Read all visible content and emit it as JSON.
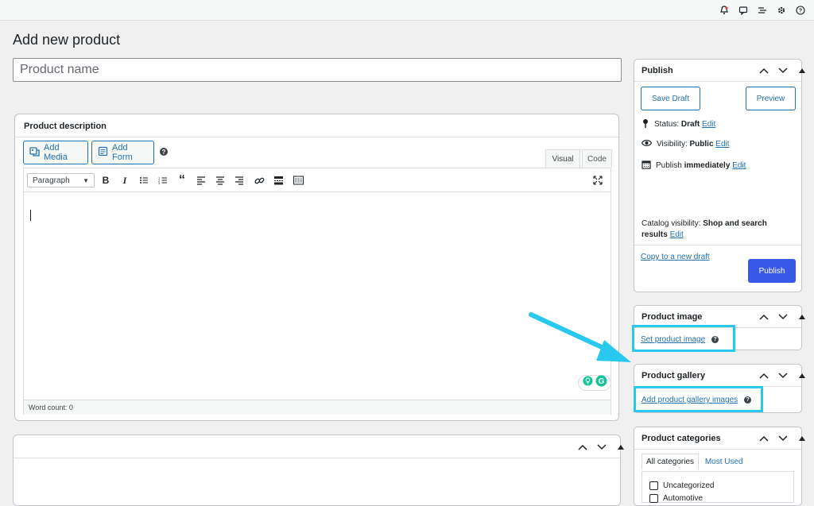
{
  "page": {
    "title": "Add new product"
  },
  "topbar": {
    "icons": [
      "bell-icon",
      "comment-icon",
      "list-icon",
      "gear-icon",
      "help-icon"
    ]
  },
  "product": {
    "name_placeholder": "Product name"
  },
  "description": {
    "title": "Product description",
    "add_media": "Add Media",
    "add_form": "Add Form",
    "tab_visual": "Visual",
    "tab_code": "Code",
    "format_select": "Paragraph",
    "word_count": "Word count: 0"
  },
  "publish": {
    "title": "Publish",
    "save_draft": "Save Draft",
    "preview": "Preview",
    "status_label": "Status:",
    "status_value": "Draft",
    "visibility_label": "Visibility:",
    "visibility_value": "Public",
    "publish_label": "Publish",
    "publish_value": "immediately",
    "edit": "Edit",
    "catalog_label": "Catalog visibility:",
    "catalog_value": "Shop and search results",
    "copy_draft": "Copy to a new draft",
    "publish_button": "Publish"
  },
  "product_image": {
    "title": "Product image",
    "link": "Set product image"
  },
  "product_gallery": {
    "title": "Product gallery",
    "link": "Add product gallery images"
  },
  "product_categories": {
    "title": "Product categories",
    "tab_all": "All categories",
    "tab_most": "Most Used",
    "items": [
      "Uncategorized",
      "Automotive"
    ]
  },
  "colors": {
    "accent": "#2271b1",
    "publish": "#3858e9",
    "highlight": "#29c8ef"
  }
}
